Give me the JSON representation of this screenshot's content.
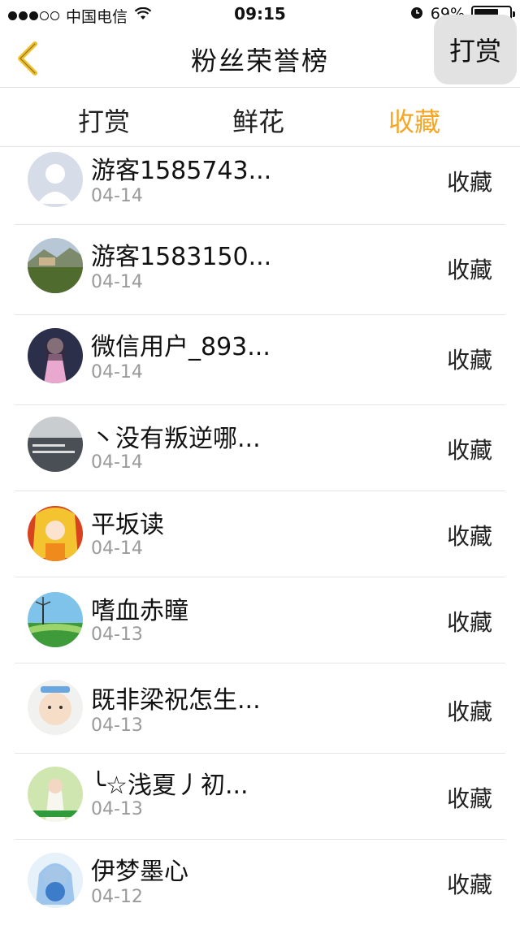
{
  "status_bar": {
    "carrier": "中国电信",
    "time": "09:15",
    "battery": "69%",
    "battery_level": 0.69
  },
  "nav": {
    "title": "粉丝荣誉榜",
    "reward_button": "打赏"
  },
  "tabs": [
    {
      "label": "打赏",
      "active": false
    },
    {
      "label": "鲜花",
      "active": false
    },
    {
      "label": "收藏",
      "active": true
    }
  ],
  "accent_color": "#f5a623",
  "items": [
    {
      "name": "游客1585743...",
      "date": "04-14",
      "action": "收藏",
      "avatar": "default-avatar"
    },
    {
      "name": "游客1583150...",
      "date": "04-14",
      "action": "收藏",
      "avatar": "landscape-avatar"
    },
    {
      "name": "微信用户_893...",
      "date": "04-14",
      "action": "收藏",
      "avatar": "anime-girl-avatar"
    },
    {
      "name": "丶没有叛逆哪...",
      "date": "04-14",
      "action": "收藏",
      "avatar": "text-photo-avatar"
    },
    {
      "name": "平坂读",
      "date": "04-14",
      "action": "收藏",
      "avatar": "anime-avatar"
    },
    {
      "name": "嗜血赤瞳",
      "date": "04-13",
      "action": "收藏",
      "avatar": "scenery-avatar"
    },
    {
      "name": "既非梁祝怎生...",
      "date": "04-13",
      "action": "收藏",
      "avatar": "child-avatar"
    },
    {
      "name": "╰☆浅夏丿初...",
      "date": "04-13",
      "action": "收藏",
      "avatar": "girl-photo-avatar"
    },
    {
      "name": "伊梦墨心",
      "date": "04-12",
      "action": "收藏",
      "avatar": "blue-anime-avatar"
    }
  ]
}
